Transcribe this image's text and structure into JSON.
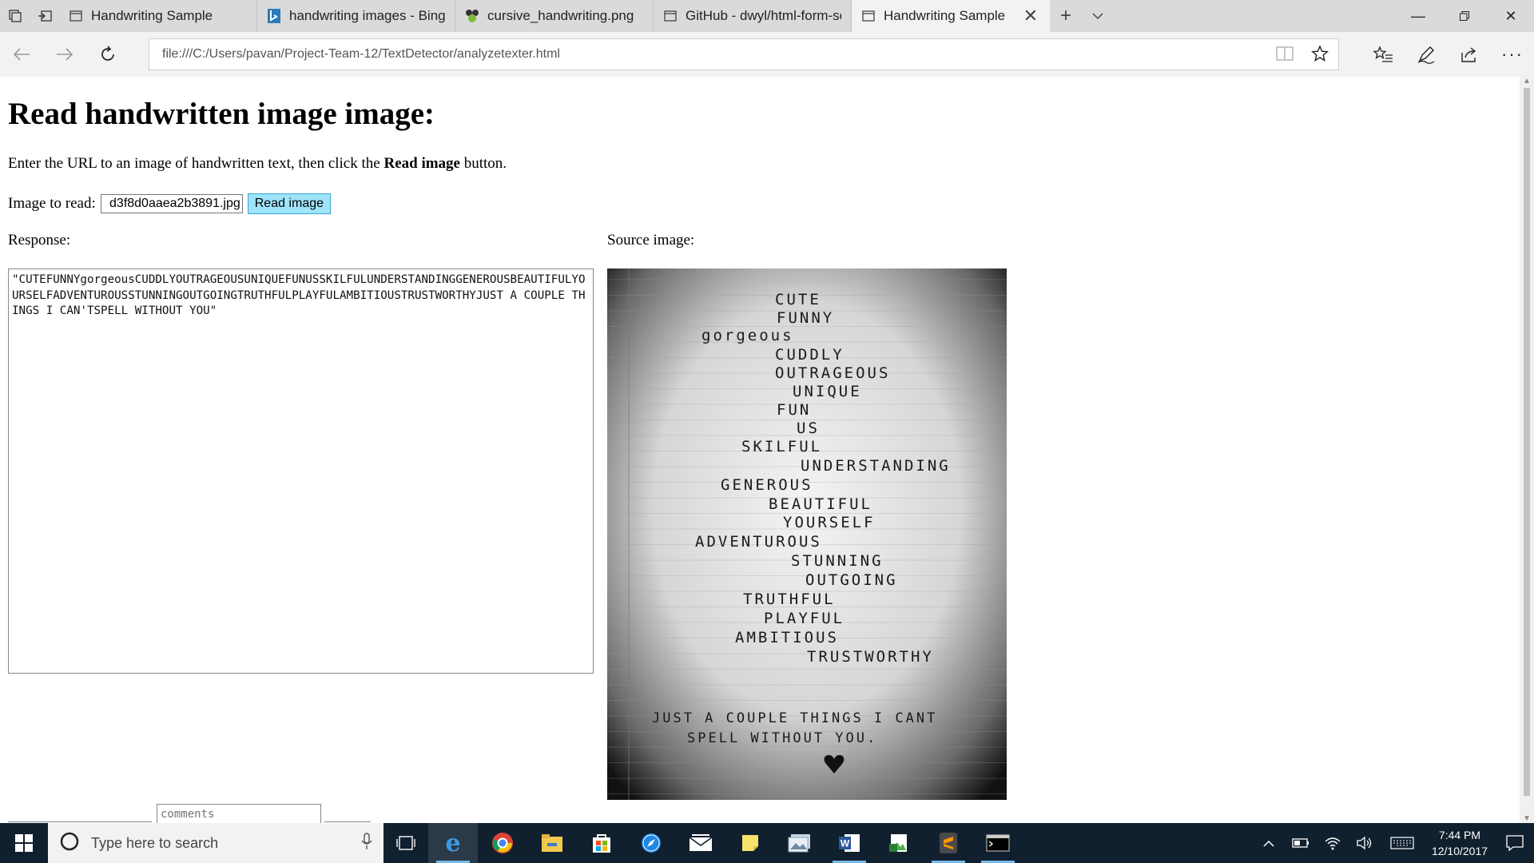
{
  "browser": {
    "tabs": [
      {
        "label": "Handwriting Sample",
        "icon": "page-icon",
        "active": false
      },
      {
        "label": "handwriting images - Bing i",
        "icon": "bing-icon",
        "active": false
      },
      {
        "label": "cursive_handwriting.png",
        "icon": "image-icon",
        "active": false
      },
      {
        "label": "GitHub - dwyl/html-form-se",
        "icon": "page-icon",
        "active": false
      },
      {
        "label": "Handwriting Sample",
        "icon": "page-icon",
        "active": true
      }
    ],
    "address": "file:///C:/Users/pavan/Project-Team-12/TextDetector/analyzetexter.html"
  },
  "page": {
    "heading": "Read handwritten image image:",
    "intro_prefix": "Enter the URL to an image of handwritten text, then click the ",
    "intro_bold": "Read image",
    "intro_suffix": " button.",
    "image_label": "Image to read:",
    "image_url_value": "d3f8d0aaea2b3891.jpg",
    "read_button": "Read image",
    "response_label": "Response:",
    "source_label": "Source image:",
    "response_text": "\"CUTEFUNNYgorgeousCUDDLYOUTRAGEOUSUNIQUEFUNUSSKILFULUNDERSTANDINGGENEROUSBEAUTIFULYOURSELFADVENTUROUSSTUNNINGOUTGOINGTRUTHFULPLAYFULAMBITIOUSTRUSTWORTHYJUST A COUPLE THINGS I CAN'TSPELL WITHOUT YOU\"",
    "comments_placeholder": "comments"
  },
  "source_image": {
    "words": [
      "CUTE",
      "FUNNY",
      "gorgeous",
      "CUDDLY",
      "OUTRAGEOUS",
      "UNIQUE",
      "FUN",
      "US",
      "SKILFUL",
      "UNDERSTANDING",
      "GENEROUS",
      "BEAUTIFUL",
      "YOURSELF",
      "ADVENTUROUS",
      "STUNNING",
      "OUTGOING",
      "TRUTHFUL",
      "PLAYFUL",
      "AMBITIOUS",
      "TRUSTWORTHY"
    ],
    "footer_line1": "JUST A COUPLE THINGS I CANT",
    "footer_line2": "SPELL WITHOUT YOU."
  },
  "taskbar": {
    "search_placeholder": "Type here to search",
    "time": "7:44 PM",
    "date": "12/10/2017",
    "apps": [
      "edge-icon",
      "chrome-icon",
      "file-explorer-icon",
      "store-icon",
      "safari-icon",
      "mail-icon",
      "sticky-notes-icon",
      "photos-icon",
      "word-icon",
      "image-app-icon",
      "sublime-icon",
      "terminal-icon"
    ]
  }
}
